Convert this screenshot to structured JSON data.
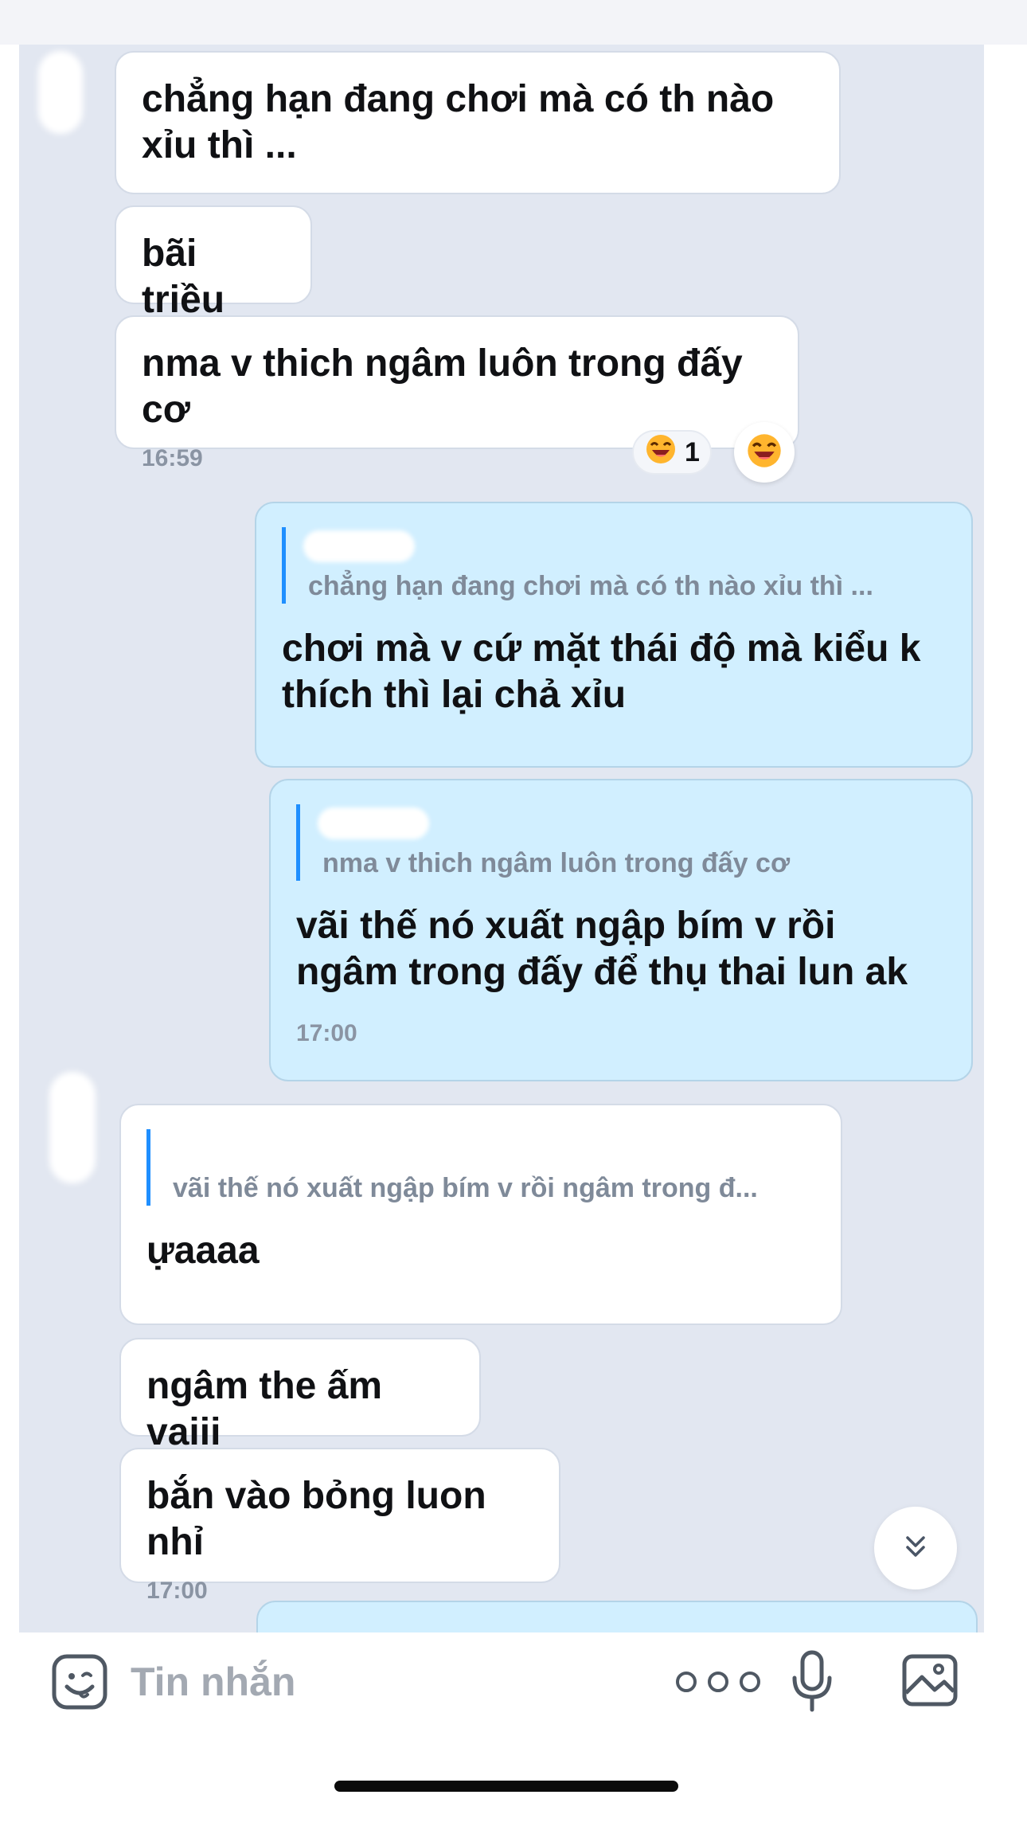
{
  "messages": [
    {
      "from": "other",
      "text": "chẳng hạn đang chơi mà có th nào xỉu thì ..."
    },
    {
      "from": "other",
      "text": "bãi triều"
    },
    {
      "from": "other",
      "text": "nma v thich ngâm luôn trong đấy cơ",
      "time": "16:59",
      "reaction": {
        "emoji": "laughing-emoji",
        "count": "1"
      }
    },
    {
      "from": "me",
      "quote": "chẳng hạn đang chơi mà có th nào xỉu thì ...",
      "text": "chơi mà v cứ mặt thái độ mà kiểu k thích thì lại chả xỉu"
    },
    {
      "from": "me",
      "quote": "nma v thich ngâm luôn trong đấy cơ",
      "text": "vãi thế nó xuất ngập bím v rồi ngâm trong đấy để thụ thai lun ak",
      "time": "17:00"
    },
    {
      "from": "other",
      "quote": "vãi thế nó xuất ngập bím v rồi ngâm trong đ...",
      "text": "ựaaaa"
    },
    {
      "from": "other",
      "text": "ngâm the ấm vaiii"
    },
    {
      "from": "other",
      "text": "bắn vào bỏng luon nhỉ",
      "time": "17:00"
    }
  ],
  "composer": {
    "placeholder": "Tin nhắn",
    "icons": [
      "emoji-icon",
      "more-icon",
      "microphone-icon",
      "image-icon"
    ]
  },
  "colors": {
    "chat_background": "#e2e7f1",
    "incoming_bubble": "#ffffff",
    "outgoing_bubble": "#d1efff",
    "quote_bar": "#1f8fff"
  }
}
